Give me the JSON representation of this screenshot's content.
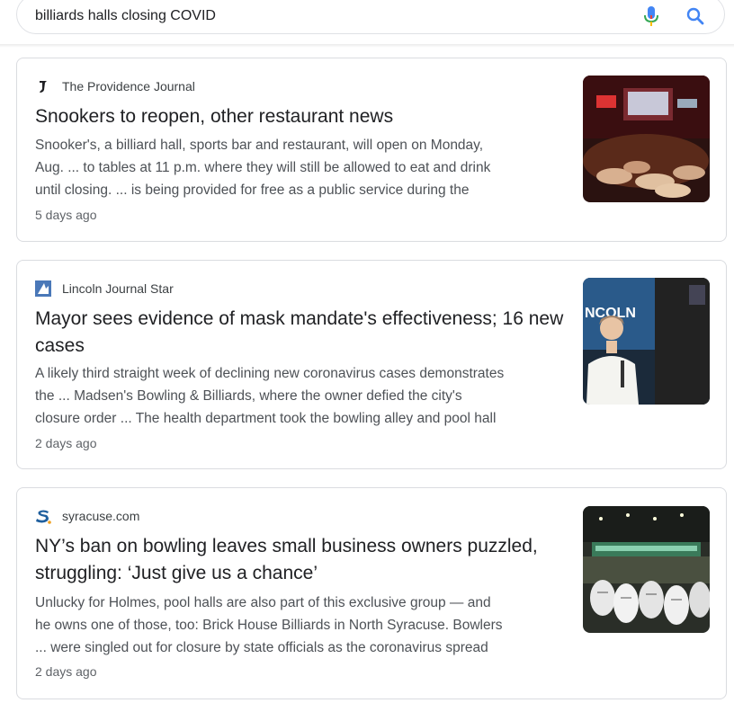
{
  "search": {
    "query": "billiards halls closing COVID",
    "mic_icon": "mic-icon",
    "search_icon": "search-icon"
  },
  "results": [
    {
      "source": "The Providence Journal",
      "logo_icon": "providence-journal-logo",
      "title": "Snookers to reopen, other restaurant news",
      "snippet": [
        "Snooker's, a billiard hall, sports bar and restaurant, will open on Monday,",
        "Aug. ... to tables at 11 p.m. where they will still be allowed to eat and drink",
        "until closing. ... is being provided for free as a public service during the"
      ],
      "time": "5 days ago"
    },
    {
      "source": "Lincoln Journal Star",
      "logo_icon": "lincoln-journal-star-logo",
      "title": "Mayor sees evidence of mask mandate's effectiveness; 16 new cases",
      "snippet": [
        "A likely third straight week of declining new coronavirus cases demonstrates",
        "the ... Madsen's Bowling & Billiards, where the owner defied the city's",
        "closure order ... The health department took the bowling alley and pool hall"
      ],
      "time": "2 days ago",
      "thumb_text": "NCOLN"
    },
    {
      "source": "syracuse.com",
      "logo_icon": "syracuse-logo",
      "title": "NY’s ban on bowling leaves small business owners puzzled, struggling: ‘Just give us a chance’",
      "snippet": [
        "Unlucky for Holmes, pool halls are also part of this exclusive group — and",
        "he owns one of those, too: Brick House Billiards in North Syracuse. Bowlers",
        "... were singled out for closure by state officials as the coronavirus spread"
      ],
      "time": "2 days ago"
    }
  ]
}
